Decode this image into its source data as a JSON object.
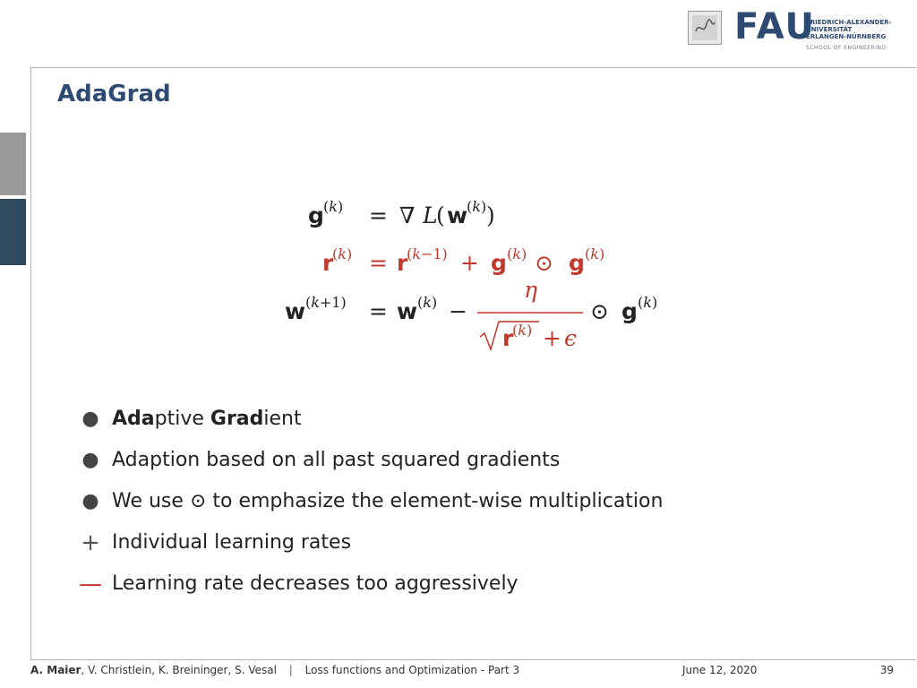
{
  "header": {
    "logo_text": "FAU",
    "university_lines": [
      "FRIEDRICH-ALEXANDER-",
      "UNIVERSITÄT",
      "ERLANGEN-NÜRNBERG"
    ],
    "school": "SCHOOL OF ENGINEERING"
  },
  "slide": {
    "title": "AdaGrad",
    "accent_color": "#2d4a72",
    "highlight_color": "#c0392b"
  },
  "bullets": [
    {
      "marker": "dot-icon",
      "parts": [
        {
          "text": "Ada",
          "bold": true
        },
        {
          "text": "ptive ",
          "bold": false
        },
        {
          "text": "Grad",
          "bold": true
        },
        {
          "text": "ient",
          "bold": false
        }
      ]
    },
    {
      "marker": "dot-icon",
      "text": "Adaption based on all past squared gradients"
    },
    {
      "marker": "dot-icon",
      "text_before": "We use ",
      "symbol": "⊙",
      "text_after": " to emphasize the element-wise multiplication"
    },
    {
      "marker": "plus-icon",
      "text": "Individual learning rates"
    },
    {
      "marker": "minus-icon",
      "text": "Learning rate decreases too aggressively"
    }
  ],
  "footer": {
    "author_bold": "A. Maier",
    "authors_rest": ", V. Christlein, K. Breininger, S. Vesal",
    "separator": "|",
    "lecture": "Loss functions and Optimization - Part 3",
    "date": "June 12, 2020",
    "page": "39"
  }
}
